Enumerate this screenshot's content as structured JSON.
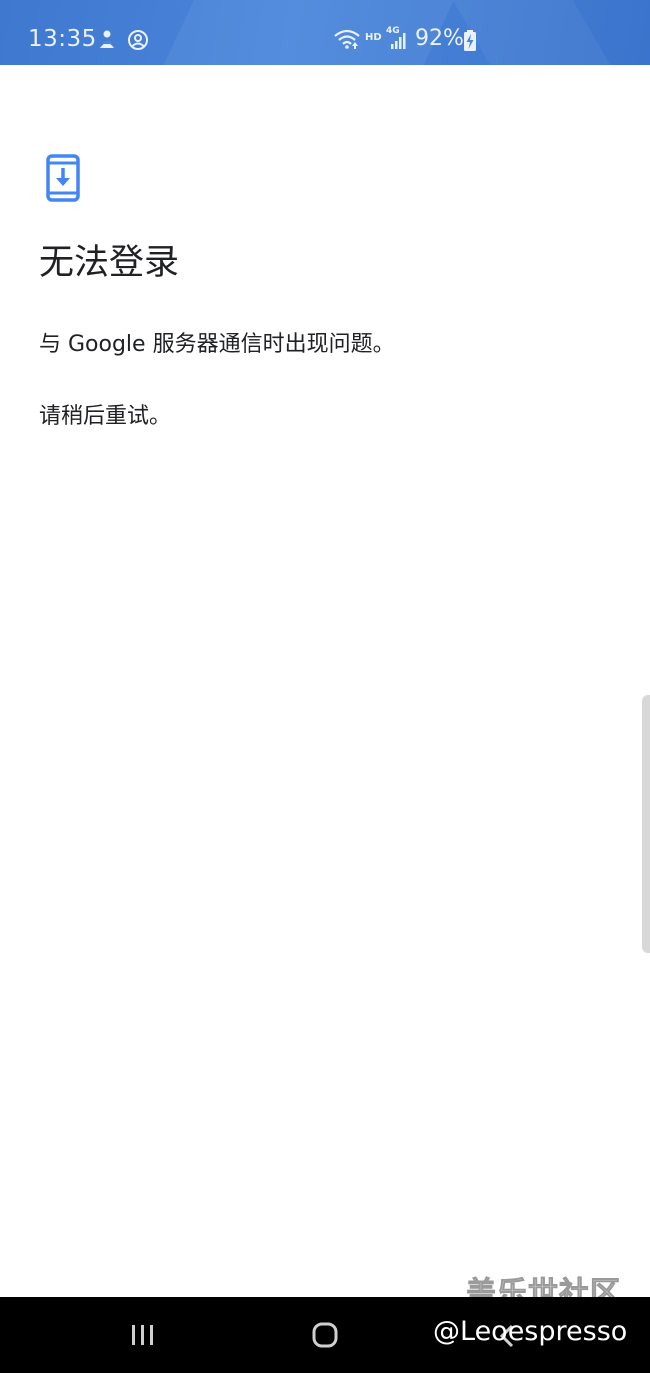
{
  "status_bar": {
    "time": "13:35",
    "hd_label": "HD",
    "network_label": "4G",
    "battery_percent": "92%",
    "icons": [
      "notification-icon",
      "account-icon",
      "wifi-icon",
      "signal-icon",
      "battery-charging-icon"
    ]
  },
  "content": {
    "icon": "phone-download-icon",
    "title": "无法登录",
    "message": "与 Google 服务器通信时出现问题。",
    "retry_hint": "请稍后重试。"
  },
  "nav_bar": {
    "buttons": [
      "recent-apps-button",
      "home-button",
      "back-button"
    ]
  },
  "watermark": {
    "title": "盖乐世社区",
    "handle": "@Leoespresso"
  },
  "colors": {
    "status_bar": "#4a86db",
    "accent": "#4285f4",
    "text": "#202124",
    "nav_bar": "#000000"
  }
}
